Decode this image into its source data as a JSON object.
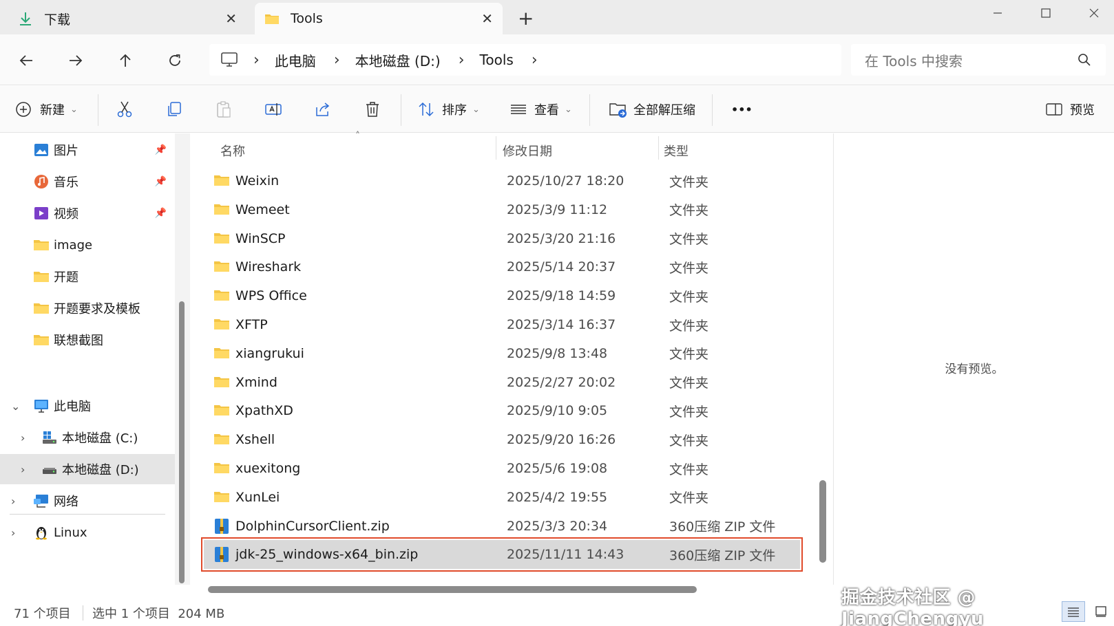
{
  "tabs": [
    {
      "label": "下载",
      "icon": "download-icon"
    },
    {
      "label": "Tools",
      "icon": "folder-icon"
    }
  ],
  "window": {
    "minimize": "—",
    "maximize": "☐",
    "close": "✕"
  },
  "address": {
    "crumbs": [
      "此电脑",
      "本地磁盘 (D:)",
      "Tools"
    ]
  },
  "search": {
    "placeholder": "在 Tools 中搜索"
  },
  "toolbar": {
    "new_label": "新建",
    "sort_label": "排序",
    "view_label": "查看",
    "extract_label": "全部解压缩",
    "more_label": "•••",
    "preview_label": "预览"
  },
  "sidebar": {
    "quick": [
      {
        "label": "图片",
        "icon": "pictures-icon",
        "pinned": true
      },
      {
        "label": "音乐",
        "icon": "music-icon",
        "pinned": true
      },
      {
        "label": "视频",
        "icon": "videos-icon",
        "pinned": true
      },
      {
        "label": "image",
        "icon": "folder-icon",
        "pinned": false
      },
      {
        "label": "开题",
        "icon": "folder-icon",
        "pinned": false
      },
      {
        "label": "开题要求及模板",
        "icon": "folder-icon",
        "pinned": false
      },
      {
        "label": "联想截图",
        "icon": "folder-icon",
        "pinned": false
      }
    ],
    "this_pc": "此电脑",
    "drive_c": "本地磁盘 (C:)",
    "drive_d": "本地磁盘 (D:)",
    "network": "网络",
    "linux": "Linux"
  },
  "columns": {
    "name": "名称",
    "date": "修改日期",
    "type": "类型"
  },
  "files": [
    {
      "name": "Weixin",
      "date": "2025/10/27 18:20",
      "type": "文件夹",
      "kind": "folder"
    },
    {
      "name": "Wemeet",
      "date": "2025/3/9 11:12",
      "type": "文件夹",
      "kind": "folder"
    },
    {
      "name": "WinSCP",
      "date": "2025/3/20 21:16",
      "type": "文件夹",
      "kind": "folder"
    },
    {
      "name": "Wireshark",
      "date": "2025/5/14 20:37",
      "type": "文件夹",
      "kind": "folder"
    },
    {
      "name": "WPS Office",
      "date": "2025/9/18 14:59",
      "type": "文件夹",
      "kind": "folder"
    },
    {
      "name": "XFTP",
      "date": "2025/3/14 16:37",
      "type": "文件夹",
      "kind": "folder"
    },
    {
      "name": "xiangrukui",
      "date": "2025/9/8 13:48",
      "type": "文件夹",
      "kind": "folder"
    },
    {
      "name": "Xmind",
      "date": "2025/2/27 20:02",
      "type": "文件夹",
      "kind": "folder"
    },
    {
      "name": "XpathXD",
      "date": "2025/9/10 9:05",
      "type": "文件夹",
      "kind": "folder"
    },
    {
      "name": "Xshell",
      "date": "2025/9/20 16:26",
      "type": "文件夹",
      "kind": "folder"
    },
    {
      "name": "xuexitong",
      "date": "2025/5/6 19:08",
      "type": "文件夹",
      "kind": "folder"
    },
    {
      "name": "XunLei",
      "date": "2025/4/2 19:55",
      "type": "文件夹",
      "kind": "folder"
    },
    {
      "name": "DolphinCursorClient.zip",
      "date": "2025/3/3 20:34",
      "type": "360压缩 ZIP 文件",
      "kind": "zip"
    },
    {
      "name": "jdk-25_windows-x64_bin.zip",
      "date": "2025/11/11 14:43",
      "type": "360压缩 ZIP 文件",
      "kind": "zip",
      "selected": true
    }
  ],
  "preview": {
    "empty_text": "没有预览。"
  },
  "status": {
    "count": "71 个项目",
    "selected": "选中 1 个项目  204 MB"
  },
  "watermark": "掘金技术社区 @ JiangChengyu",
  "colors": {
    "selection_outline": "#e04a2a",
    "selection_bg": "#d9d9d9",
    "folder": "#f4c545"
  }
}
